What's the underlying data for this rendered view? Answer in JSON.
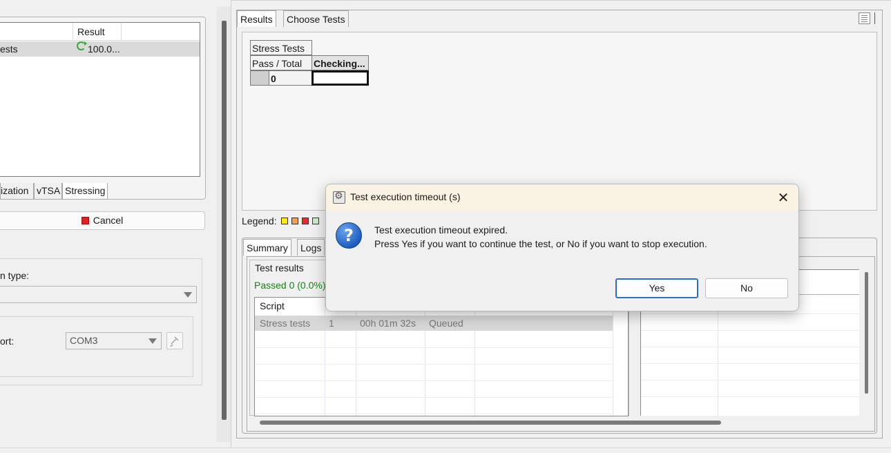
{
  "left_panel": {
    "table": {
      "column_result": "Result",
      "row": {
        "name": "ests",
        "result": "100.0..."
      }
    },
    "tabs": [
      "ization",
      "vTSA",
      "Stressing"
    ],
    "cancel_label": "Cancel",
    "connection_type_label": "n type:",
    "port_label": "ort:",
    "port_value": "COM3"
  },
  "right_panel": {
    "tabs": [
      "Results",
      "Choose Tests"
    ],
    "grid": {
      "title": "Stress Tests",
      "col1": "Pass / Total",
      "col2": "Checking...",
      "value": "0"
    },
    "legend_label": "Legend:",
    "legend_colors": [
      "#ffee00",
      "#f0a050",
      "#e03030",
      "#c8ecc8"
    ],
    "bottom_tabs": [
      "Summary",
      "Logs"
    ],
    "test_results_title": "Test results",
    "passed_text": "Passed 0 (0.0%)",
    "script_header": "Script",
    "row": {
      "script": "Stress tests",
      "num": "1",
      "time": "00h 01m 32s",
      "status": "Queued"
    }
  },
  "dialog": {
    "title": "Test execution timeout (s)",
    "message_line1": "Test execution timeout expired.",
    "message_line2": "Press Yes if you want to continue the test, or No if you want to stop execution.",
    "yes_label": "Yes",
    "no_label": "No",
    "close_glyph": "✕",
    "question_glyph": "?"
  }
}
